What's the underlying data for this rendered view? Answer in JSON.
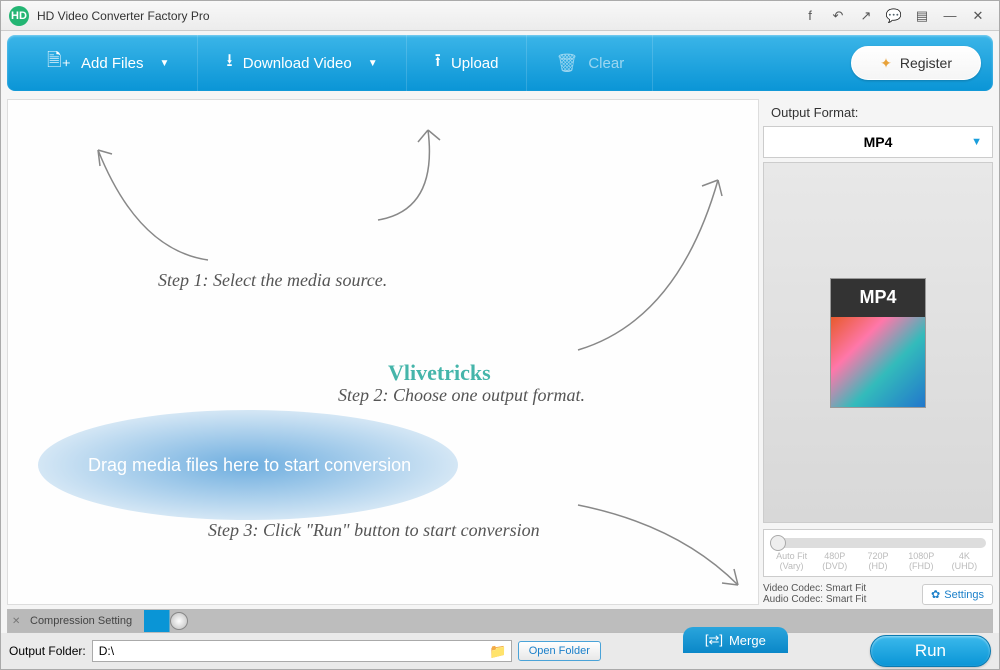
{
  "titlebar": {
    "title": "HD Video Converter Factory Pro"
  },
  "toolbar": {
    "add_files": "Add Files",
    "download_video": "Download Video",
    "upload": "Upload",
    "clear": "Clear",
    "register": "Register"
  },
  "canvas": {
    "step1": "Step 1: Select the media source.",
    "step2": "Step 2: Choose one output format.",
    "step3": "Step 3: Click \"Run\" button to start conversion",
    "drag_text": "Drag media files here to start conversion",
    "watermark": "Vlivetricks"
  },
  "sidebar": {
    "output_format_label": "Output Format:",
    "selected_format": "MP4",
    "thumb_label": "MP4",
    "resolutions": [
      {
        "k": "Auto Fit",
        "s": "(Vary)"
      },
      {
        "k": "480P",
        "s": "(DVD)"
      },
      {
        "k": "720P",
        "s": "(HD)"
      },
      {
        "k": "1080P",
        "s": "(FHD)"
      },
      {
        "k": "4K",
        "s": "(UHD)"
      }
    ],
    "codec_video": "Video Codec: Smart Fit",
    "codec_audio": "Audio Codec: Smart Fit",
    "settings": "Settings"
  },
  "compression": {
    "label": "Compression Setting"
  },
  "bottom": {
    "output_folder_label": "Output Folder:",
    "output_folder_value": "D:\\",
    "open_folder": "Open Folder",
    "merge": "Merge",
    "run": "Run"
  }
}
